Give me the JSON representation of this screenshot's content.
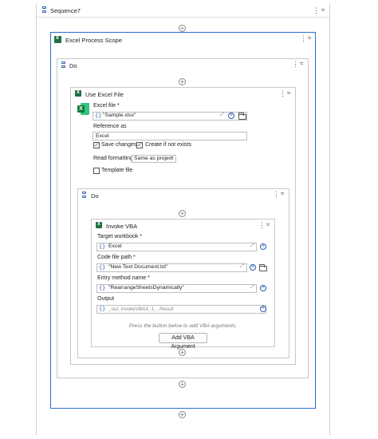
{
  "sequence": {
    "title": "Sequence7"
  },
  "excel_scope": {
    "title": "Excel Process Scope"
  },
  "do_outer": {
    "title": "Do"
  },
  "use_excel": {
    "title": "Use Excel File",
    "excel_file_label": "Excel file *",
    "excel_file_value": "\"Sample.xlsx\"",
    "reference_as_label": "Reference as",
    "reference_as_value": "Excel",
    "save_changes_label": "Save changes",
    "save_changes_checked": true,
    "create_if_not_exists_label": "Create if not exists",
    "create_if_not_exists_checked": true,
    "read_formatting_label": "Read formatting",
    "read_formatting_value": "Same as project",
    "template_file_label": "Template file",
    "template_file_checked": false
  },
  "do_inner": {
    "title": "Do"
  },
  "invoke_vba": {
    "title": "Invoke VBA",
    "target_workbook_label": "Target workbook *",
    "target_workbook_value": "Excel",
    "code_file_path_label": "Code file path *",
    "code_file_path_value": "\"New Text Document.txt\"",
    "entry_method_label": "Entry method name *",
    "entry_method_value": "\"RearrangeSheetsDynamically\"",
    "output_label": "Output",
    "output_placeholder": "_out_InvokeVBAX_1__Result",
    "hint_text": "Press the button below to add VBA arguments.",
    "add_button_label": "Add VBA Argument"
  },
  "glyphs": {
    "curly": "{}",
    "dots": "⋮",
    "collapse": "≈",
    "plus": "+",
    "expand": "⤢",
    "dropdown": "⌄"
  },
  "colors": {
    "accent": "#2a5db0",
    "excel_green": "#1e7145",
    "selected_border": "#2a6fd6"
  }
}
